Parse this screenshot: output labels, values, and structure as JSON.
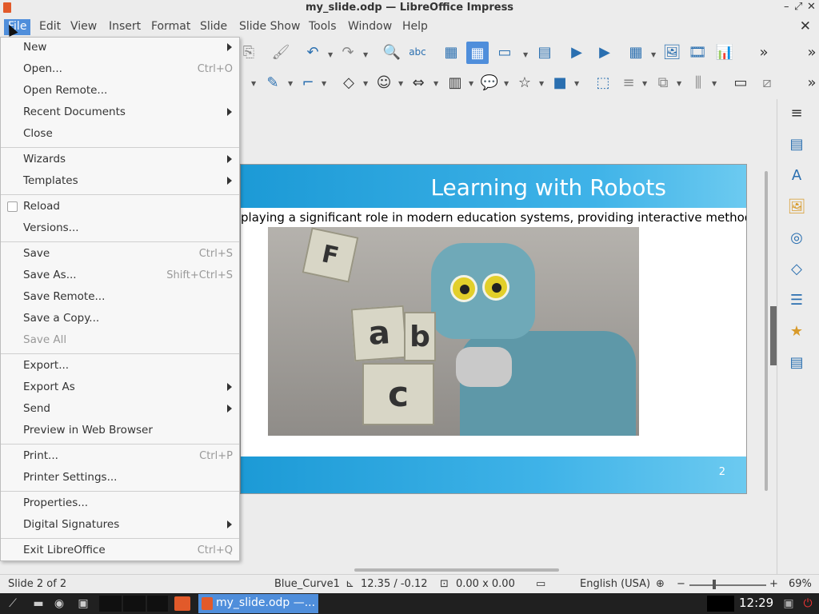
{
  "window": {
    "title": "my_slide.odp — LibreOffice Impress",
    "controls": [
      "–",
      "⤢",
      "✕"
    ]
  },
  "menubar": {
    "items": [
      "File",
      "Edit",
      "View",
      "Insert",
      "Format",
      "Slide",
      "Slide Show",
      "Tools",
      "Window",
      "Help"
    ],
    "active": "File",
    "close_doc": "✕"
  },
  "file_menu": {
    "items": [
      {
        "label": "New",
        "submenu": true
      },
      {
        "label": "Open...",
        "shortcut": "Ctrl+O"
      },
      {
        "label": "Open Remote..."
      },
      {
        "label": "Recent Documents",
        "submenu": true
      },
      {
        "label": "Close"
      },
      {
        "label": "Wizards",
        "submenu": true
      },
      {
        "label": "Templates",
        "submenu": true
      },
      {
        "label": "Reload",
        "checkbox": true
      },
      {
        "label": "Versions..."
      },
      {
        "label": "Save",
        "shortcut": "Ctrl+S"
      },
      {
        "label": "Save As...",
        "shortcut": "Shift+Ctrl+S"
      },
      {
        "label": "Save Remote..."
      },
      {
        "label": "Save a Copy..."
      },
      {
        "label": "Save All",
        "disabled": true
      },
      {
        "label": "Export..."
      },
      {
        "label": "Export As",
        "submenu": true
      },
      {
        "label": "Send",
        "submenu": true
      },
      {
        "label": "Preview in Web Browser"
      },
      {
        "label": "Print...",
        "shortcut": "Ctrl+P"
      },
      {
        "label": "Printer Settings..."
      },
      {
        "label": "Properties..."
      },
      {
        "label": "Digital Signatures",
        "submenu": true
      },
      {
        "label": "Exit LibreOffice",
        "shortcut": "Ctrl+Q"
      }
    ]
  },
  "slide": {
    "title": "Learning with Robots",
    "subtitle": "playing a significant role in modern education systems, providing interactive methods.",
    "page_number": "2",
    "blocks": [
      "F",
      "a",
      "b",
      "c"
    ]
  },
  "statusbar": {
    "slide_info": "Slide 2 of 2",
    "master": "Blue_Curve1",
    "position": "12.35 / -0.12",
    "size": "0.00 x 0.00",
    "language": "English (USA)",
    "zoom": "69%",
    "zoom_minus": "−",
    "zoom_plus": "+"
  },
  "taskbar": {
    "task_label": "my_slide.odp —...",
    "clock": "12:29"
  },
  "colors": {
    "accent": "#4f8edb",
    "slide_band": "#3fb3e8",
    "icon_blue": "#2a6fb0"
  }
}
